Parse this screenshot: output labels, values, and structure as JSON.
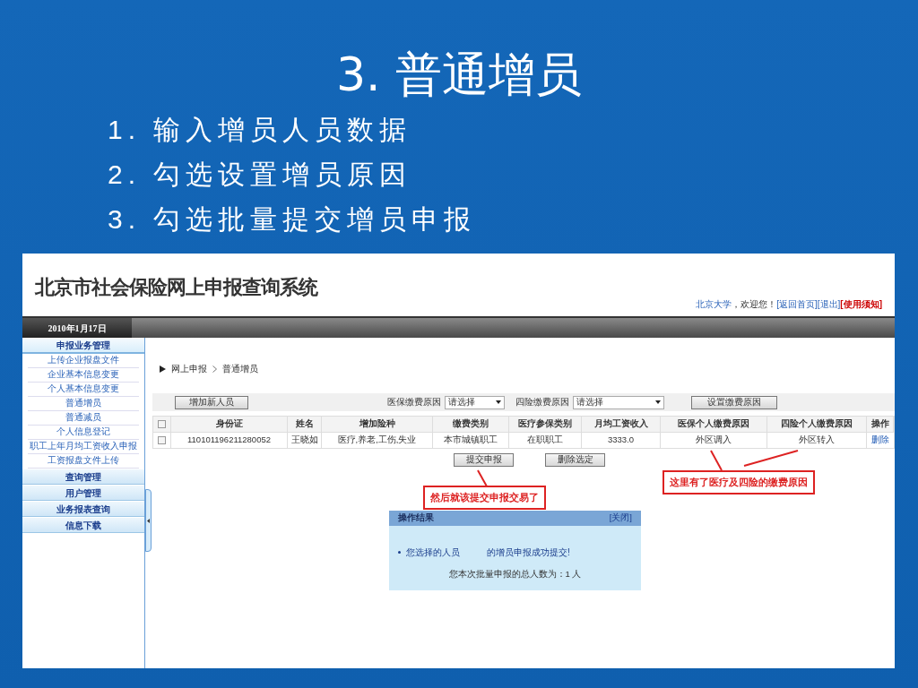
{
  "slide": {
    "title": "3. 普通增员",
    "bullets": [
      "1. 输入增员人员数据",
      "2. 勾选设置增员原因",
      "3. 勾选批量提交增员申报"
    ]
  },
  "app": {
    "logo": "北京市社会保险网上申报查询系统",
    "user_links": [
      {
        "kind": "user",
        "text": "北京大学"
      },
      {
        "kind": "text",
        "text": "，欢迎您！"
      },
      {
        "kind": "link",
        "text": "[返回首页]"
      },
      {
        "kind": "link",
        "text": "[退出]"
      },
      {
        "kind": "notice",
        "text": "[使用须知]"
      }
    ],
    "date": "2010年1月17日",
    "sidebar": [
      {
        "label": "申报业务管理",
        "expanded": true,
        "items": [
          "上传企业报盘文件",
          "企业基本信息变更",
          "个人基本信息变更",
          "普通增员",
          "普通减员",
          "个人信息登记",
          "职工上年月均工资收入申报",
          "工资报盘文件上传"
        ]
      },
      {
        "label": "查询管理",
        "expanded": false
      },
      {
        "label": "用户管理",
        "expanded": false
      },
      {
        "label": "业务报表查询",
        "expanded": false
      },
      {
        "label": "信息下载",
        "expanded": false
      }
    ],
    "breadcrumb": [
      "网上申报",
      "普通增员"
    ],
    "toolbar": {
      "add_button": "增加新人员",
      "med_reason": {
        "label": "医保缴费原因",
        "value": "请选择"
      },
      "four_reason": {
        "label": "四险缴费原因",
        "value": "请选择"
      },
      "set_button": "设置缴费原因"
    },
    "table": {
      "all_checked": false,
      "columns": [
        "身份证",
        "姓名",
        "增加险种",
        "缴费类别",
        "医疗参保类别",
        "月均工资收入",
        "医保个人缴费原因",
        "四险个人缴费原因",
        "操作"
      ],
      "rows": [
        {
          "checked": false,
          "cells": [
            "110101196211280052",
            "王晓如",
            "医疗,养老,工伤,失业",
            "本市城镇职工",
            "在职职工",
            "3333.0",
            "外区调入",
            "外区转入"
          ],
          "action": "删除"
        }
      ]
    },
    "buttons": [
      "提交申报",
      "删除选定"
    ],
    "annotations": [
      "然后就该提交申报交易了",
      "这里有了医疗及四险的缴费原因"
    ],
    "result_panel": {
      "title": "操作结果",
      "close": "[关闭]",
      "message": [
        "您选择的人员",
        "的增员申报成功提交!"
      ],
      "total": "您本次批量申报的总人数为：1 人"
    }
  }
}
